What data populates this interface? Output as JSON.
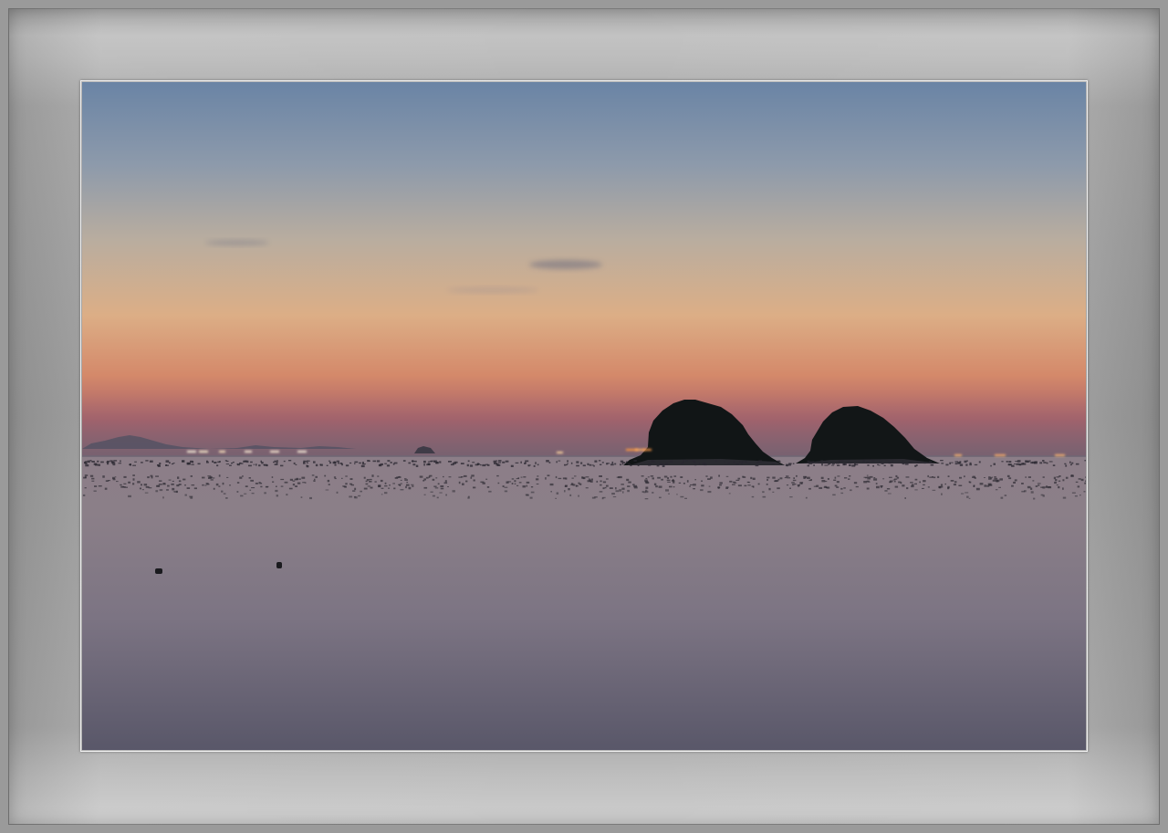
{
  "scene": {
    "subject": "twin-islands-at-dusk",
    "colors": {
      "sky_top": "#6b85a6",
      "sky_mid": "#b6a79a",
      "sky_glow": "#e0a878",
      "sky_horizon": "#c2705a",
      "haze": "#7e6b72",
      "sea_near_horizon": "#8a7d86",
      "sea_mid": "#857a86",
      "sea_bottom": "#5e5a6c",
      "island": "#111516",
      "mat_light": "#c9c9c9",
      "mat_dark": "#9d9d9d"
    }
  }
}
